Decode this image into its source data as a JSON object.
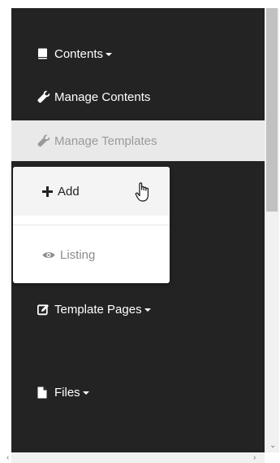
{
  "nav": {
    "contents_label": "Contents",
    "manage_contents_label": "Manage Contents",
    "manage_templates_label": "Manage Templates",
    "template_pages_label": "Template Pages",
    "files_label": "Files"
  },
  "dropdown": {
    "add_label": "Add",
    "listing_label": "Listing"
  },
  "colors": {
    "sidebar_bg": "#232323",
    "active_bg": "#e9e9e9",
    "active_text": "#9a9a9a",
    "dropdown_bg": "#ffffff",
    "listing_text": "#8c8c8c"
  },
  "icons": {
    "contents": "book-icon",
    "manage_contents": "wrench-icon",
    "manage_templates": "wrench-icon",
    "add": "plus-icon",
    "listing": "eye-icon",
    "template_pages": "edit-icon",
    "files": "file-icon",
    "cursor": "hand-pointer-icon"
  }
}
